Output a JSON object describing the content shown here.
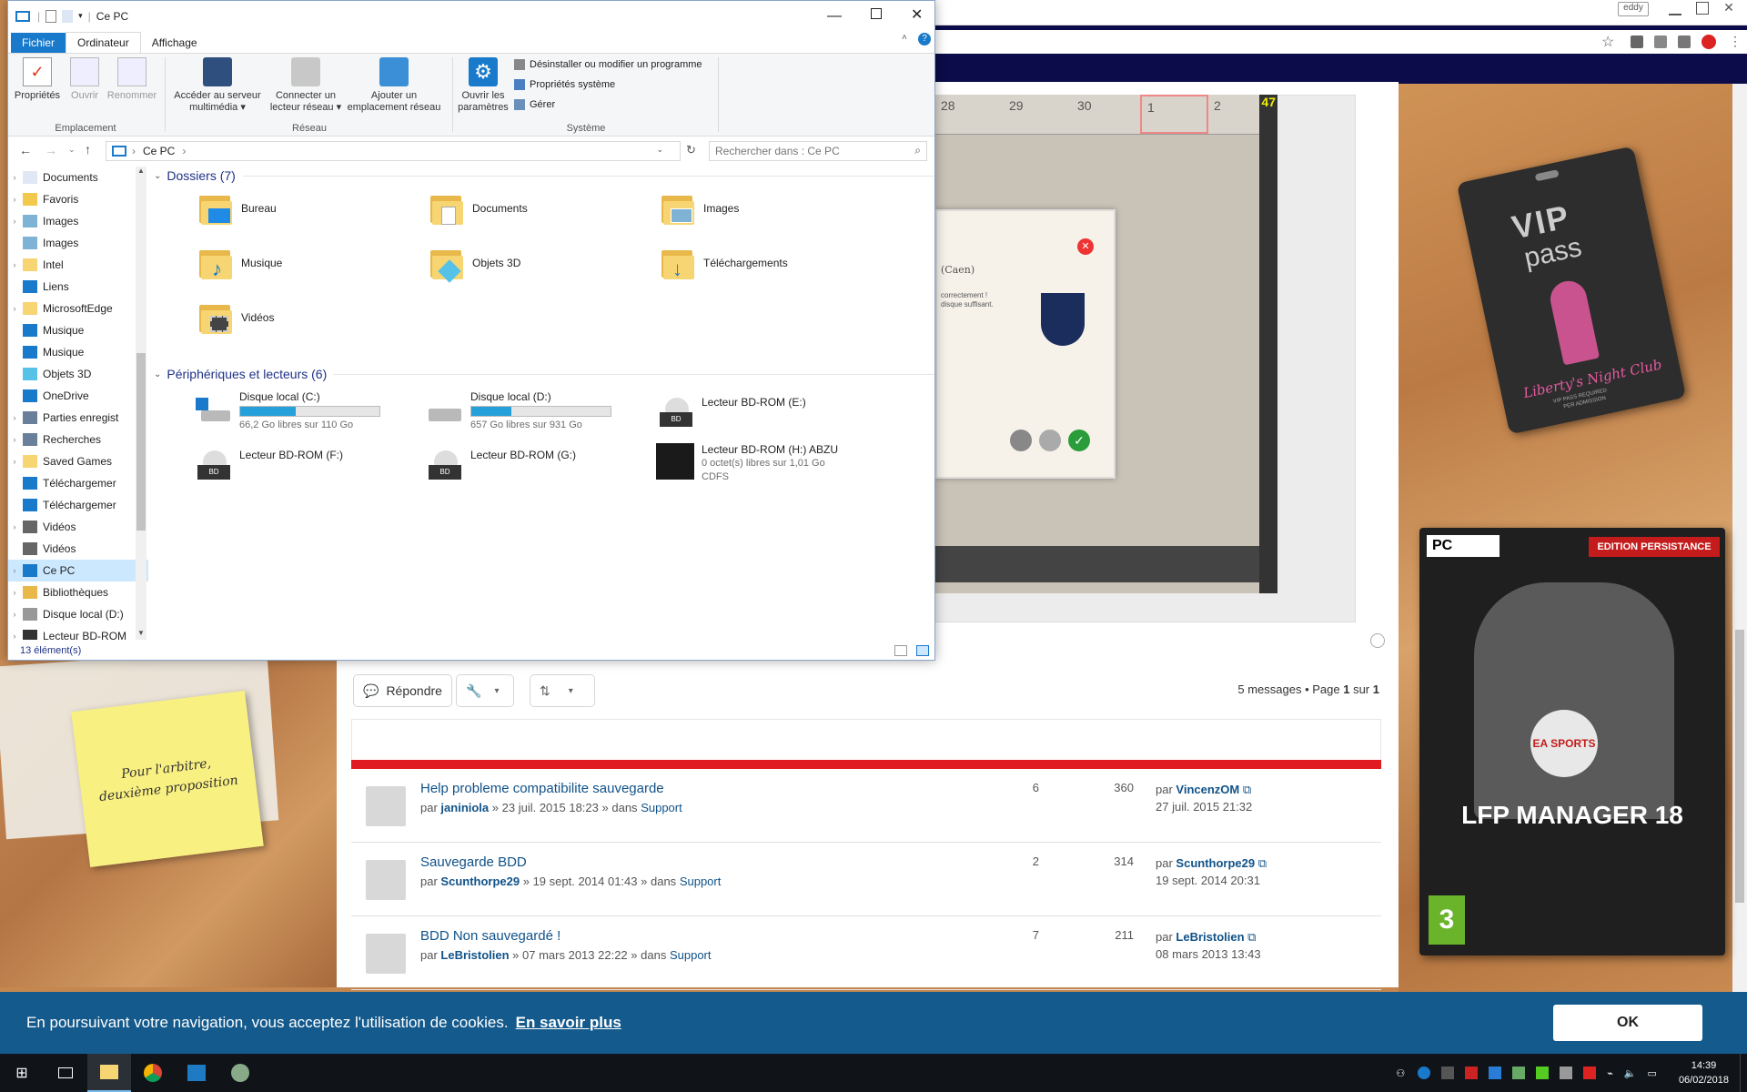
{
  "explorer": {
    "title": "Ce PC",
    "tabs": {
      "file": "Fichier",
      "computer": "Ordinateur",
      "view": "Affichage"
    },
    "ribbon": {
      "properties": "Propriétés",
      "open": "Ouvrir",
      "rename": "Renommer",
      "group_location": "Emplacement",
      "media_server_l1": "Accéder au serveur",
      "media_server_l2": "multimédia ▾",
      "map_drive_l1": "Connecter un",
      "map_drive_l2": "lecteur réseau ▾",
      "add_location_l1": "Ajouter un",
      "add_location_l2": "emplacement réseau",
      "group_network": "Réseau",
      "open_settings_l1": "Ouvrir les",
      "open_settings_l2": "paramètres",
      "uninstall": "Désinstaller ou modifier un programme",
      "system_props": "Propriétés système",
      "manage": "Gérer",
      "group_system": "Système"
    },
    "address": "Ce PC",
    "search_placeholder": "Rechercher dans : Ce PC",
    "nav": [
      {
        "label": "Documents",
        "icon": "documents-icon",
        "chev": "›"
      },
      {
        "label": "Favoris",
        "icon": "star-icon",
        "chev": "›"
      },
      {
        "label": "Images",
        "icon": "images-icon",
        "chev": "›"
      },
      {
        "label": "Images",
        "icon": "images-icon",
        "chev": ""
      },
      {
        "label": "Intel",
        "icon": "folder-icon",
        "chev": "›"
      },
      {
        "label": "Liens",
        "icon": "link-icon",
        "chev": ""
      },
      {
        "label": "MicrosoftEdge",
        "icon": "folder-icon",
        "chev": "›"
      },
      {
        "label": "Musique",
        "icon": "music-icon",
        "chev": ""
      },
      {
        "label": "Musique",
        "icon": "music-icon",
        "chev": ""
      },
      {
        "label": "Objets 3D",
        "icon": "cube-icon",
        "chev": ""
      },
      {
        "label": "OneDrive",
        "icon": "cloud-icon",
        "chev": ""
      },
      {
        "label": "Parties enregist",
        "icon": "gamepad-icon",
        "chev": "›"
      },
      {
        "label": "Recherches",
        "icon": "search-icon",
        "chev": "›"
      },
      {
        "label": "Saved Games",
        "icon": "folder-icon",
        "chev": "›"
      },
      {
        "label": "Téléchargemer",
        "icon": "download-icon",
        "chev": ""
      },
      {
        "label": "Téléchargemer",
        "icon": "download-icon",
        "chev": ""
      },
      {
        "label": "Vidéos",
        "icon": "video-icon",
        "chev": "›"
      },
      {
        "label": "Vidéos",
        "icon": "video-icon",
        "chev": ""
      },
      {
        "label": "Ce PC",
        "icon": "computer-icon",
        "chev": "›"
      },
      {
        "label": "Bibliothèques",
        "icon": "library-icon",
        "chev": "›"
      },
      {
        "label": "Disque local (D:)",
        "icon": "drive-icon",
        "chev": "›"
      },
      {
        "label": "Lecteur BD-ROM",
        "icon": "bd-drive-icon",
        "chev": "›"
      }
    ],
    "folders_header": "Dossiers (7)",
    "folders": [
      "Bureau",
      "Documents",
      "Images",
      "Musique",
      "Objets 3D",
      "Téléchargements",
      "Vidéos"
    ],
    "devices_header": "Périphériques et lecteurs (6)",
    "devices": [
      {
        "name": "Disque local (C:)",
        "sub": "66,2 Go libres sur 110 Go",
        "used": 0.4
      },
      {
        "name": "Disque local (D:)",
        "sub": "657 Go libres sur 931 Go",
        "used": 0.29
      },
      {
        "name": "Lecteur BD-ROM (E:)",
        "sub": ""
      },
      {
        "name": "Lecteur BD-ROM (F:)",
        "sub": ""
      },
      {
        "name": "Lecteur BD-ROM (G:)",
        "sub": ""
      },
      {
        "name": "Lecteur BD-ROM (H:) ABZU",
        "sub": "0 octet(s) libres sur 1,01 Go",
        "sub2": "CDFS"
      }
    ],
    "status": "13 élément(s)"
  },
  "game": {
    "calendar": [
      "28",
      "29",
      "30",
      "1",
      "2"
    ],
    "fps": "47",
    "dialog_text_1": "(Caen)",
    "dialog_text_2": "correctement !",
    "dialog_text_3": "disque suffisant."
  },
  "forum": {
    "reply": "Répondre",
    "pagination": {
      "prefix": "5 messages • Page ",
      "page": "1",
      "mid": " sur ",
      "total": "1"
    },
    "topics": [
      {
        "title": "Help probleme compatibilite sauvegarde",
        "author": "janiniola",
        "date": "23 juil. 2015 18:23",
        "forum": "Support",
        "replies": "6",
        "views": "360",
        "last_by": "VincenzOM",
        "last_date": "27 juil. 2015 21:32"
      },
      {
        "title": "Sauvegarde BDD",
        "author": "Scunthorpe29",
        "date": "19 sept. 2014 01:43",
        "forum": "Support",
        "replies": "2",
        "views": "314",
        "last_by": "Scunthorpe29",
        "last_date": "19 sept. 2014 20:31"
      },
      {
        "title": "BDD Non sauvegardé !",
        "author": "LeBristolien",
        "date": "07 mars 2013 22:22",
        "forum": "Support",
        "replies": "7",
        "views": "211",
        "last_by": "LeBristolien",
        "last_date": "08 mars 2013 13:43"
      }
    ],
    "by": "par",
    "in": "dans"
  },
  "sticky_note": {
    "line1": "Pour l'arbitre,",
    "line2": "deuxième proposition"
  },
  "vip": {
    "line1": "VIP",
    "line2": "pass",
    "club": "Liberty's Night Club",
    "small1": "VIP PASS REQUIRED",
    "small2": "PER ADMISSION"
  },
  "dvd": {
    "platform": "PC",
    "edition": "EDITION PERSISTANCE",
    "brand": "EA SPORTS",
    "title": "LFP MANAGER 18",
    "pegi": "3"
  },
  "browser": {
    "user": "eddy"
  },
  "cookie": {
    "text": "En poursuivant votre navigation, vous acceptez l'utilisation de cookies.",
    "link": "En savoir plus",
    "ok": "OK"
  },
  "taskbar": {
    "time": "14:39",
    "date": "06/02/2018"
  },
  "colors": {
    "accent": "#1979ca",
    "forum_red": "#e11b22",
    "cookie_bg": "#145a8c",
    "link": "#105289"
  }
}
